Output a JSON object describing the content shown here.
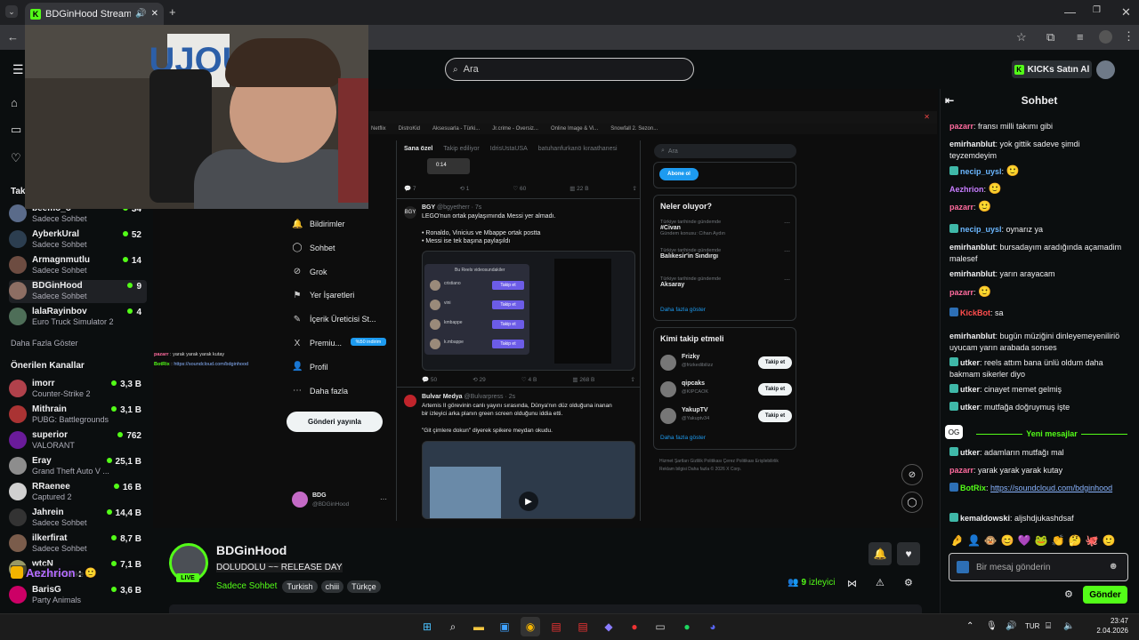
{
  "browser": {
    "tab_title": "BDGinHood Stream - Watc",
    "tab_icon": "kick-icon",
    "accent": "#53fc18"
  },
  "header": {
    "search_placeholder": "Ara",
    "kicks_button": "KICKs Satın Al"
  },
  "sidebar": {
    "followed_title": "Tak",
    "followed": [
      {
        "name": "beemo_o",
        "category": "Sadece Sohbet",
        "viewers": "34"
      },
      {
        "name": "AyberkUral",
        "category": "Sadece Sohbet",
        "viewers": "52"
      },
      {
        "name": "Armagnmutlu",
        "category": "Sadece Sohbet",
        "viewers": "14"
      },
      {
        "name": "BDGinHood",
        "category": "Sadece Sohbet",
        "viewers": "9"
      },
      {
        "name": "lalaRayinbov",
        "category": "Euro Truck Simulator 2",
        "viewers": "4"
      }
    ],
    "show_more": "Daha Fazla Göster",
    "recommended_title": "Önerilen Kanallar",
    "recommended": [
      {
        "name": "imorr",
        "category": "Counter-Strike 2",
        "viewers": "3,3 B"
      },
      {
        "name": "Mithrain",
        "category": "PUBG: Battlegrounds",
        "viewers": "3,1 B"
      },
      {
        "name": "superior",
        "category": "VALORANT",
        "viewers": "762"
      },
      {
        "name": "Eray",
        "category": "Grand Theft Auto V ...",
        "viewers": "25,1 B"
      },
      {
        "name": "RRaenee",
        "category": "Captured 2",
        "viewers": "16 B"
      },
      {
        "name": "Jahrein",
        "category": "Sadece Sohbet",
        "viewers": "14,4 B"
      },
      {
        "name": "ilkerfirat",
        "category": "Sadece Sohbet",
        "viewers": "8,7 B"
      },
      {
        "name": "wtcN",
        "category": "Counter-Strike 2",
        "viewers": "7,1 B"
      },
      {
        "name": "BarisG",
        "category": "Party Animals",
        "viewers": "3,6 B"
      }
    ],
    "overlay_user": "Aezhrion",
    "overlay_sep": ":"
  },
  "stream_screen": {
    "nav": [
      "Bildirimler",
      "Sohbet",
      "Grok",
      "Yer İşaretleri",
      "İçerik Üreticisi St...",
      "Premiu...",
      "Profil",
      "Daha fazla"
    ],
    "premium_badge": "%50 indirim",
    "post_button": "Gönderi yayınla",
    "profile_name": "BDG",
    "profile_handle": "@BDGinHood",
    "bookmarks": [
      "Netflix",
      "DistroKid",
      "Aksesuarla - Türki...",
      "Jr.crime - Oversiz...",
      "Online Image & Vi...",
      "Snowfall 2. Sezon..."
    ],
    "tabs": [
      "Sana özel",
      "Takip ediliyor",
      "IdrisUstaUSA",
      "batuhanfurkanö kıraathanesi"
    ],
    "time_badge": "0:14",
    "tweet1": {
      "name": "BGY",
      "handle": "@bgyetherr · 7s",
      "text1": "LEGO'nun ortak paylaşımında Messi yer almadı.",
      "text2": "• Ronaldo, Vinicius ve Mbappe ortak postta",
      "text3": "• Messi ise tek başına paylaşıldı",
      "popup_title": "Bu Reels videosundakiler",
      "people": [
        "cristiano",
        "vini",
        "kmbappe",
        "k.mbappe"
      ],
      "follow": "Takip et",
      "stats": [
        "50",
        "29",
        "4 B",
        "268 B"
      ]
    },
    "tweet0_stats": [
      "7",
      "1",
      "60",
      "22 B"
    ],
    "tweet2": {
      "name": "Bulvar Medya",
      "handle": "@Bulvarpress · 2s",
      "text1": "Artemis II görevinin canlı yayını sırasında, Dünya'nın düz olduğuna inanan",
      "text2": "bir izleyici arka planın green screen olduğunu iddia etti.",
      "text3": "\"Git çimlere dokun\" diyerek spikere meydan okudu."
    },
    "search_placeholder": "Ara",
    "subscribe": "Abone ol",
    "trends_title": "Neler oluyor?",
    "trends": [
      {
        "meta": "Türkiye tarihinde gündemde",
        "name": "#Civan",
        "extra": "Gündem konusu: Cihan Aydın"
      },
      {
        "meta": "Türkiye tarihinde gündemde",
        "name": "Balıkesir'in Sındırgı",
        "extra": ""
      },
      {
        "meta": "Türkiye tarihinde gündemde",
        "name": "Aksaray",
        "extra": ""
      }
    ],
    "show_more": "Daha fazla göster",
    "who_title": "Kimi takip etmeli",
    "who": [
      {
        "name": "Frizky",
        "handle": "@frizkedibilizz",
        "btn": "Takip et"
      },
      {
        "name": "qipcaks",
        "handle": "@KIPCAOK",
        "btn": "Takip et"
      },
      {
        "name": "YakupTV",
        "handle": "@Yakuptv34",
        "btn": "Takip et"
      }
    ],
    "who_more": "Daha fazla göster",
    "footer": "Hizmet Şartları  Gizlilik Politikası  Çerez Politikası  Erişilebilirlik  Reklam bilgisi  Daha fazla  © 2026 X Corp.",
    "overlay_chat": [
      {
        "user": "pazarr",
        "text": "yarak yarak yarak kutay"
      },
      {
        "user": "BotRix",
        "text": "https://soundcloud.com/bdginhood"
      }
    ]
  },
  "stream_info": {
    "streamer": "BDGinHood",
    "title": "DOLUDOLU ~~ RELEASE DAY",
    "category": "Sadece Sohbet",
    "tags": [
      "Turkish",
      "chiii",
      "Türkçe"
    ],
    "viewers": "9",
    "viewers_label": "izleyici",
    "live": "LIVE"
  },
  "chat": {
    "title": "Sohbet",
    "messages": [
      {
        "user": "pazarr",
        "color": "#ff6b9e",
        "text": "fransı milli takımı gibi"
      },
      {
        "user": "emirhanblut",
        "color": "#efeff1",
        "text": "yok gittik sadeve şimdi teyzemdeyim"
      },
      {
        "user": "necip_uysl",
        "color": "#6bb7ff",
        "text": ""
      },
      {
        "user": "Aezhrion",
        "color": "#c77dff",
        "text": ""
      },
      {
        "user": "pazarr",
        "color": "#ff6b9e",
        "text": ""
      },
      {
        "user": "necip_uysl",
        "color": "#6bb7ff",
        "text": "oynarız ya"
      },
      {
        "user": "emirhanblut",
        "color": "#efeff1",
        "text": "bursadayım aradığında açamadim malesef"
      },
      {
        "user": "emirhanblut",
        "color": "#efeff1",
        "text": "yarın arayacam"
      },
      {
        "user": "pazarr",
        "color": "#ff6b9e",
        "text": ""
      },
      {
        "user": "KickBot",
        "color": "#ff4d4d",
        "text": "sa"
      },
      {
        "user": "emirhanblut",
        "color": "#efeff1",
        "text": "bugün müziğini dinleyemeyeniliriö uyucam yarın arabada sonses"
      },
      {
        "user": "utker",
        "color": "#efeff1",
        "text": "reels attım bana ünlü oldum daha bakmam sikerler diyo"
      },
      {
        "user": "utker",
        "color": "#efeff1",
        "text": "cinayet memet gelmiş"
      },
      {
        "user": "utker",
        "color": "#efeff1",
        "text": "mutfağa doğruymuş işte"
      }
    ],
    "new_messages": "Yeni mesajlar",
    "og_badge": "OG",
    "messages2": [
      {
        "user": "utker",
        "color": "#efeff1",
        "text": "adamların mutfağı mal"
      },
      {
        "user": "pazarr",
        "color": "#ff6b9e",
        "text": "yarak yarak yarak kutay"
      },
      {
        "user": "BotRix",
        "color": "#53fc18",
        "text": "https://soundcloud.com/bdginhood"
      },
      {
        "user": "kemaldowski",
        "color": "#efeff1",
        "text": "aljshdjukashdsaf"
      }
    ],
    "input_placeholder": "Bir mesaj gönderin",
    "send": "Gönder"
  },
  "taskbar": {
    "lang": "TUR",
    "time": "23:47",
    "date": "2.04.2026"
  }
}
